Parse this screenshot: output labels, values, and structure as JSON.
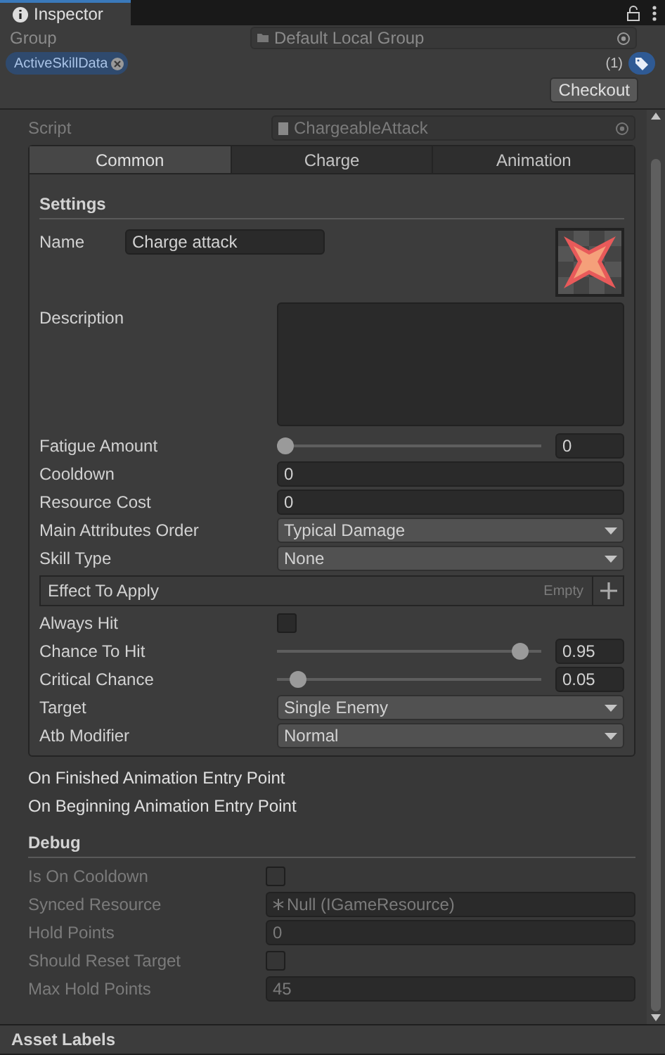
{
  "window": {
    "tab": "Inspector"
  },
  "header": {
    "group_label": "Group",
    "group_value": "Default Local Group",
    "label_chip": "ActiveSkillData",
    "label_count": "(1)",
    "checkout": "Checkout"
  },
  "script": {
    "label": "Script",
    "value": "ChargeableAttack"
  },
  "tabs": [
    {
      "label": "Common",
      "selected": true
    },
    {
      "label": "Charge",
      "selected": false
    },
    {
      "label": "Animation",
      "selected": false
    }
  ],
  "settings": {
    "title": "Settings",
    "name_label": "Name",
    "name_value": "Charge attack",
    "description_label": "Description",
    "fields": [
      {
        "kind": "slider",
        "label": "Fatigue Amount",
        "level": 0,
        "value": "0"
      },
      {
        "kind": "number",
        "label": "Cooldown",
        "value": "0"
      },
      {
        "kind": "number",
        "label": "Resource Cost",
        "value": "0"
      },
      {
        "kind": "dropdown",
        "label": "Main Attributes Order",
        "value": "Typical Damage"
      },
      {
        "kind": "dropdown",
        "label": "Skill Type",
        "value": "None"
      },
      {
        "kind": "list",
        "label": "Effect To Apply",
        "value": "Empty"
      },
      {
        "kind": "checkbox",
        "label": "Always Hit",
        "checked": false
      },
      {
        "kind": "slider",
        "label": "Chance To Hit",
        "level": 0.95,
        "value": "0.95"
      },
      {
        "kind": "slider",
        "label": "Critical Chance",
        "level": 0.05,
        "value": "0.05"
      },
      {
        "kind": "dropdown",
        "label": "Target",
        "value": "Single Enemy"
      },
      {
        "kind": "dropdown",
        "label": "Atb Modifier",
        "value": "Normal"
      }
    ]
  },
  "events": [
    "On Finished Animation Entry Point",
    "On Beginning Animation Entry Point"
  ],
  "debug": {
    "title": "Debug",
    "fields": [
      {
        "kind": "checkbox",
        "label": "Is On Cooldown",
        "checked": false
      },
      {
        "kind": "object",
        "label": "Synced Resource",
        "value": "Null (IGameResource)"
      },
      {
        "kind": "number",
        "label": "Hold Points",
        "value": "0"
      },
      {
        "kind": "checkbox",
        "label": "Should Reset Target",
        "checked": false
      },
      {
        "kind": "number",
        "label": "Max Hold Points",
        "value": "45"
      }
    ]
  },
  "footer": {
    "title": "Asset Labels"
  }
}
